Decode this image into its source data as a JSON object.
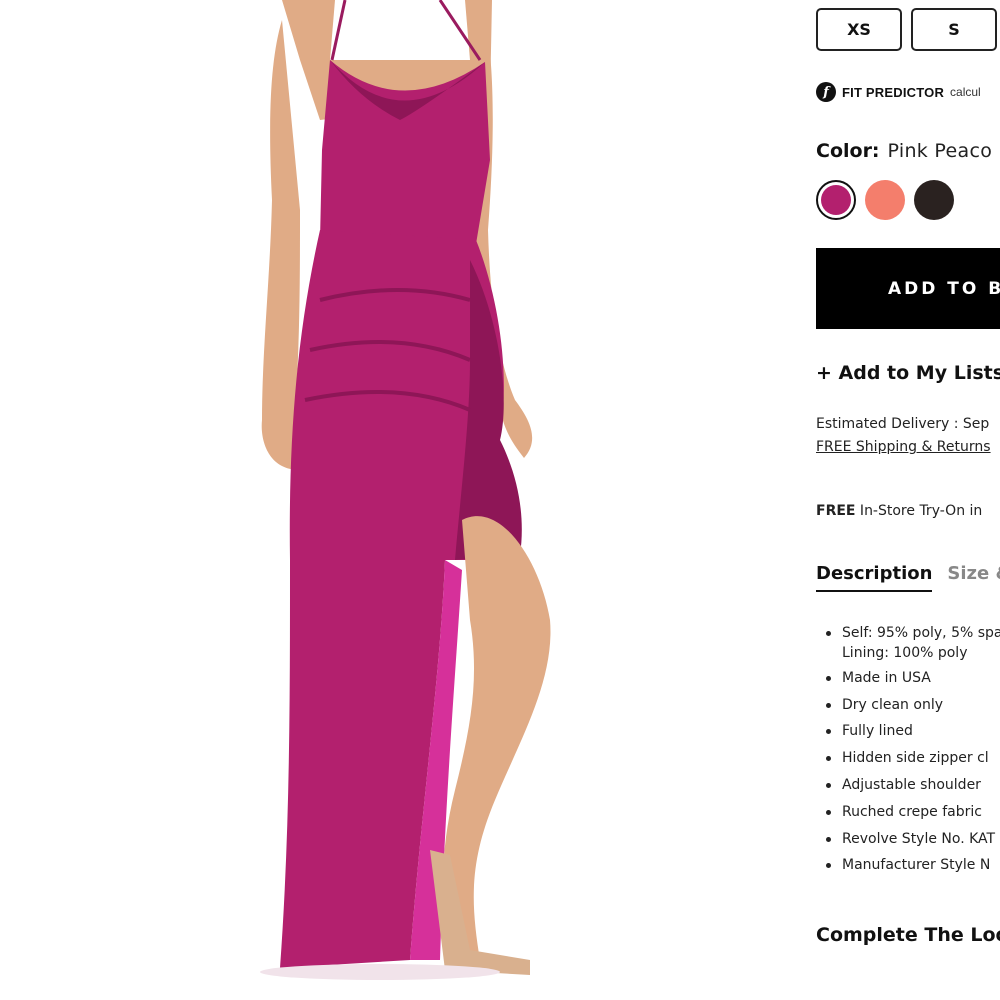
{
  "sizes": [
    "XS",
    "S"
  ],
  "fit_predictor": {
    "label": "FIT PREDICTOR",
    "sub": "calcul"
  },
  "color": {
    "label": "Color:",
    "value": "Pink Peaco",
    "swatches": [
      {
        "name": "pink-peacock",
        "hex": "#b3206e"
      },
      {
        "name": "coral",
        "hex": "#f47e6c"
      },
      {
        "name": "black",
        "hex": "#2a2220"
      }
    ]
  },
  "add_to_bag": "ADD TO BA",
  "add_to_lists": "+ Add to My Lists",
  "delivery": {
    "text": "Estimated Delivery : Sep",
    "shipping": "FREE Shipping & Returns"
  },
  "tryon": {
    "free": "FREE",
    "rest": " In-Store Try-On in"
  },
  "tabs": {
    "description": "Description",
    "size": "Size &"
  },
  "description_items": [
    {
      "line1": "Self: 95% poly, 5% spa",
      "line2": "Lining: 100% poly"
    },
    {
      "line1": "Made in USA"
    },
    {
      "line1": "Dry clean only"
    },
    {
      "line1": "Fully lined"
    },
    {
      "line1": "Hidden side zipper cl"
    },
    {
      "line1": "Adjustable shoulder"
    },
    {
      "line1": "Ruched crepe fabric"
    },
    {
      "line1": "Revolve Style No. KAT"
    },
    {
      "line1": "Manufacturer Style N"
    }
  ],
  "complete_look": "Complete The Loo",
  "colors": {
    "dress": "#b3206e",
    "dress_shadow": "#8e1657",
    "dress_lining": "#d6309a",
    "skin": "#e0ab86",
    "accent": "#000000"
  }
}
